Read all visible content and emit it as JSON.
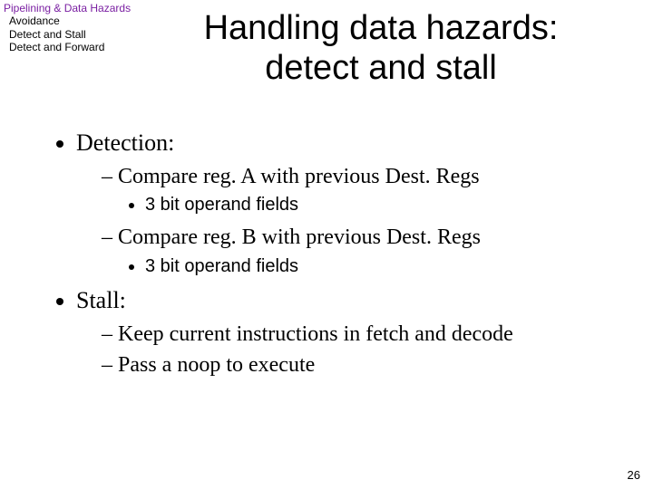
{
  "breadcrumb": {
    "topic": "Pipelining & Data Hazards",
    "items": [
      "Avoidance",
      "Detect and Stall",
      "Detect and Forward"
    ]
  },
  "title": {
    "line1": "Handling data hazards:",
    "line2": "detect and stall"
  },
  "bullets": {
    "detection": {
      "label": "Detection:",
      "sub1": "Compare reg. A with previous Dest. Regs",
      "sub1_detail": "3 bit operand fields",
      "sub2": "Compare reg. B with previous Dest. Regs",
      "sub2_detail": "3 bit operand fields"
    },
    "stall": {
      "label": "Stall:",
      "sub1": "Keep current instructions in fetch and decode",
      "sub2": "Pass a noop to execute"
    }
  },
  "page_number": "26"
}
